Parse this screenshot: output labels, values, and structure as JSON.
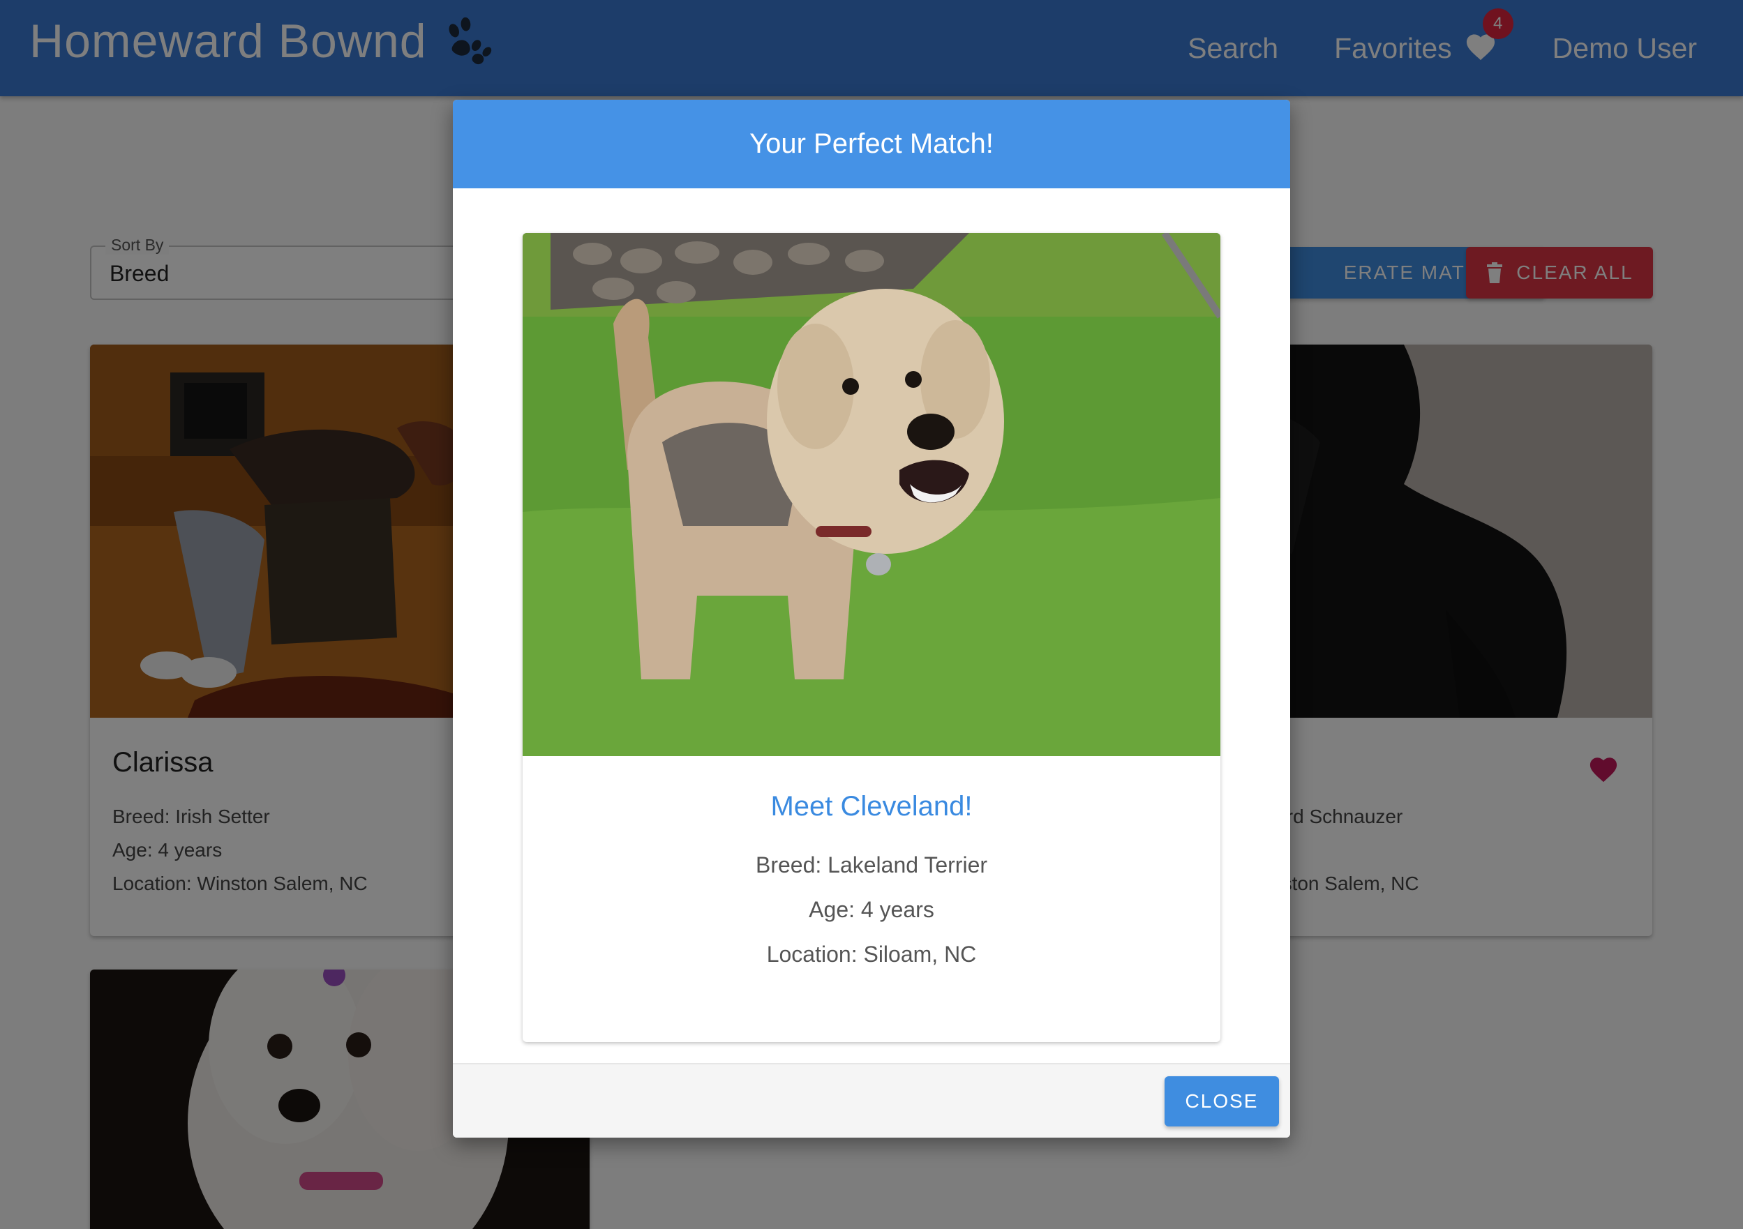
{
  "navbar": {
    "brand": "Homeward Bownd",
    "brand_icon": "paw-icon",
    "links": {
      "search": "Search",
      "favorites": "Favorites",
      "user": "Demo User"
    },
    "favorites_count": "4",
    "accent_color": "#3a7bd5"
  },
  "controls": {
    "sort_label": "Sort By",
    "sort_value": "Breed",
    "generate_label": "ERATE MATCH",
    "clear_label": "CLEAR ALL"
  },
  "cards": [
    {
      "name": "Clarissa",
      "breed": "Breed: Irish Setter",
      "age": "Age: 4 years",
      "location": "Location: Winston Salem, NC"
    },
    {
      "breed": "lard Schnauzer",
      "location": "nston Salem, NC"
    }
  ],
  "modal": {
    "title": "Your Perfect Match!",
    "match_title": "Meet Cleveland!",
    "breed": "Breed: Lakeland Terrier",
    "age": "Age: 4 years",
    "location": "Location: Siloam, NC",
    "close_label": "CLOSE"
  }
}
